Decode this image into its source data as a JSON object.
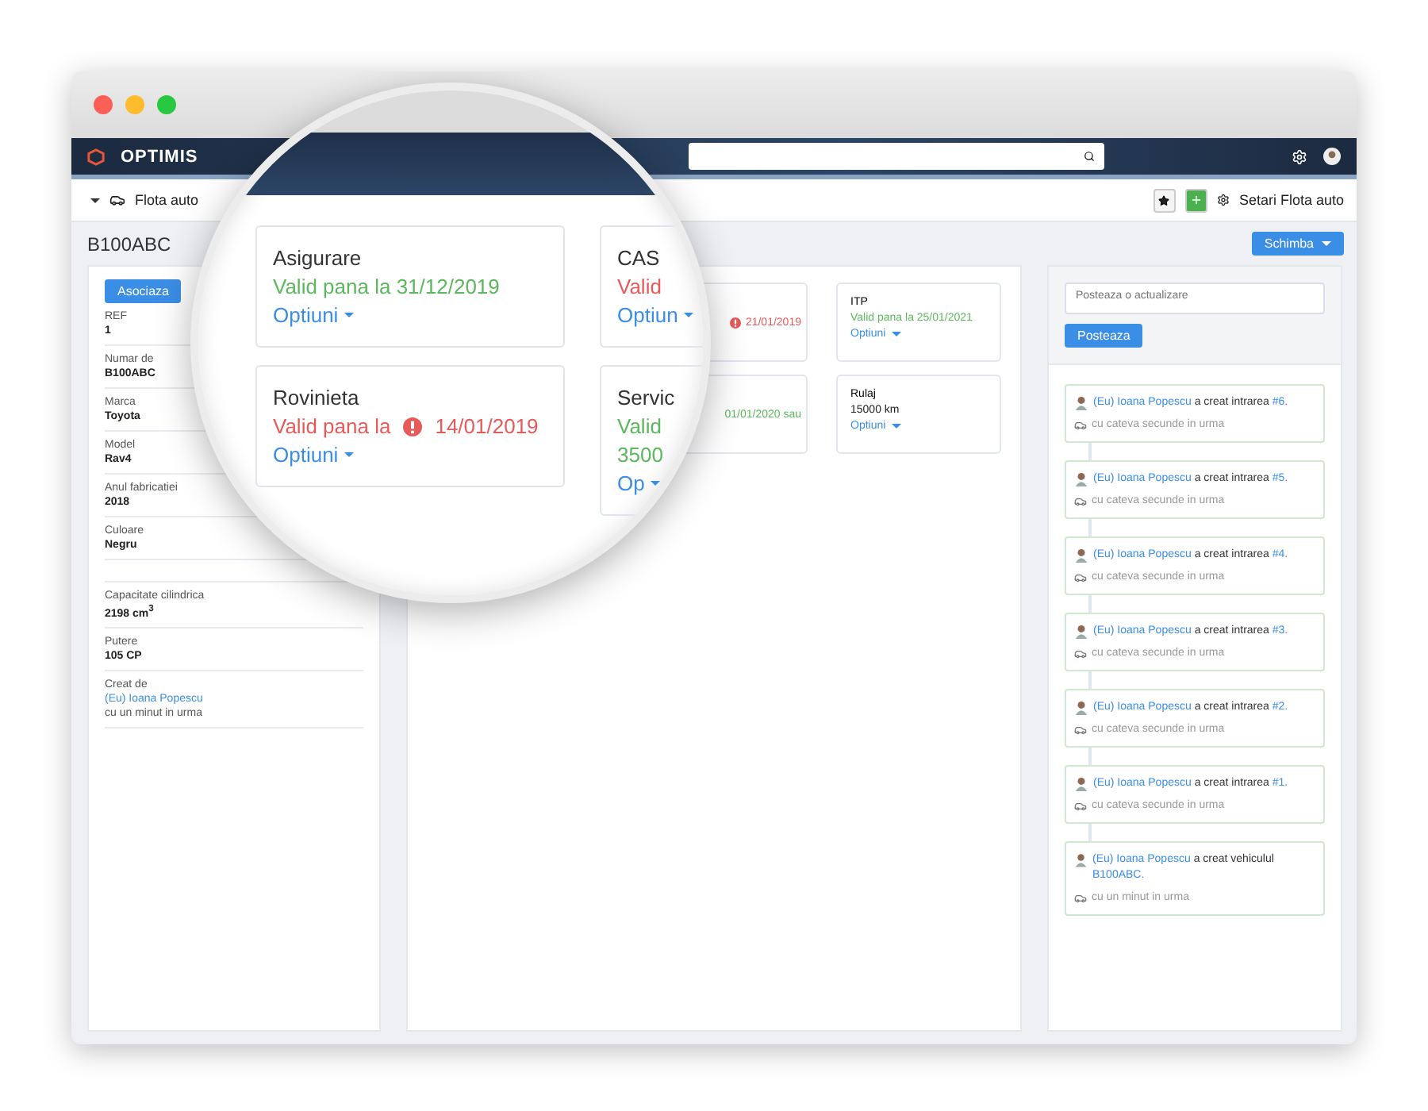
{
  "navbar": {
    "logo": "OPTIMIS"
  },
  "subheader": {
    "section": "Flota auto",
    "settings": "Setari Flota auto"
  },
  "vehicle": {
    "title": "B100ABC",
    "action": "Schimba"
  },
  "details": {
    "button": "Asociaza",
    "rows": [
      {
        "label": "REF",
        "value": "1"
      },
      {
        "label": "Numar de",
        "value": "B100ABC"
      },
      {
        "label": "Marca",
        "value": "Toyota"
      },
      {
        "label": "Model",
        "value": "Rav4"
      },
      {
        "label": "Anul fabricatiei",
        "value": "2018"
      },
      {
        "label": "Culoare",
        "value": "Negru"
      },
      {
        "kind": "empty"
      },
      {
        "label": "Capacitate cilindrica",
        "value": "2198 cm$^{3}$"
      },
      {
        "label": "Putere",
        "value": "105 CP"
      },
      {
        "label": "Creat de",
        "author": "(Eu) Ioana Popescu",
        "time": "cu un minut in urma"
      }
    ]
  },
  "documents": {
    "hidden_fragments": [
      {
        "text": "21/01/2019",
        "expired": true,
        "warning": true
      },
      {
        "text": "01/01/2020 sau",
        "expired": false,
        "warning": false
      }
    ],
    "cards": [
      {
        "kind": "status",
        "title": "ITP",
        "status": "Valid pana la 25/01/2021",
        "expired": false,
        "options": "Optiuni"
      },
      {
        "kind": "value",
        "title": "Rulaj",
        "value": "15000 km",
        "options": "Optiuni"
      }
    ]
  },
  "magnifier": {
    "cards": [
      {
        "title": "Asigurare",
        "status": "Valid pana la 31/12/2019",
        "expired": false,
        "warning": false,
        "options": "Optiuni"
      },
      {
        "title": "CAS",
        "status": "Valid",
        "expired": true,
        "warning": false,
        "options": "Optiun"
      },
      {
        "title": "Rovinieta",
        "status": "Valid pana la",
        "date": "14/01/2019",
        "expired": true,
        "warning": true,
        "options": "Optiuni"
      },
      {
        "title": "Servic",
        "status": "Valid",
        "extra": "3500",
        "expired": false,
        "warning": false,
        "options": "Op"
      }
    ]
  },
  "feed": {
    "placeholder": "Posteaza o actualizare",
    "button": "Posteaza",
    "entries": [
      {
        "author": "(Eu) Ioana Popescu",
        "action": "a creat intrarea",
        "ref": "#6.",
        "time": "cu cateva secunde in urma"
      },
      {
        "author": "(Eu) Ioana Popescu",
        "action": "a creat intrarea",
        "ref": "#5.",
        "time": "cu cateva secunde in urma"
      },
      {
        "author": "(Eu) Ioana Popescu",
        "action": "a creat intrarea",
        "ref": "#4.",
        "time": "cu cateva secunde in urma"
      },
      {
        "author": "(Eu) Ioana Popescu",
        "action": "a creat intrarea",
        "ref": "#3.",
        "time": "cu cateva secunde in urma"
      },
      {
        "author": "(Eu) Ioana Popescu",
        "action": "a creat intrarea",
        "ref": "#2.",
        "time": "cu cateva secunde in urma"
      },
      {
        "author": "(Eu) Ioana Popescu",
        "action": "a creat intrarea",
        "ref": "#1.",
        "time": "cu cateva secunde in urma"
      },
      {
        "author": "(Eu) Ioana Popescu",
        "action": "a creat vehiculul",
        "ref": "B100ABC.",
        "time": "cu un minut in urma"
      }
    ]
  }
}
